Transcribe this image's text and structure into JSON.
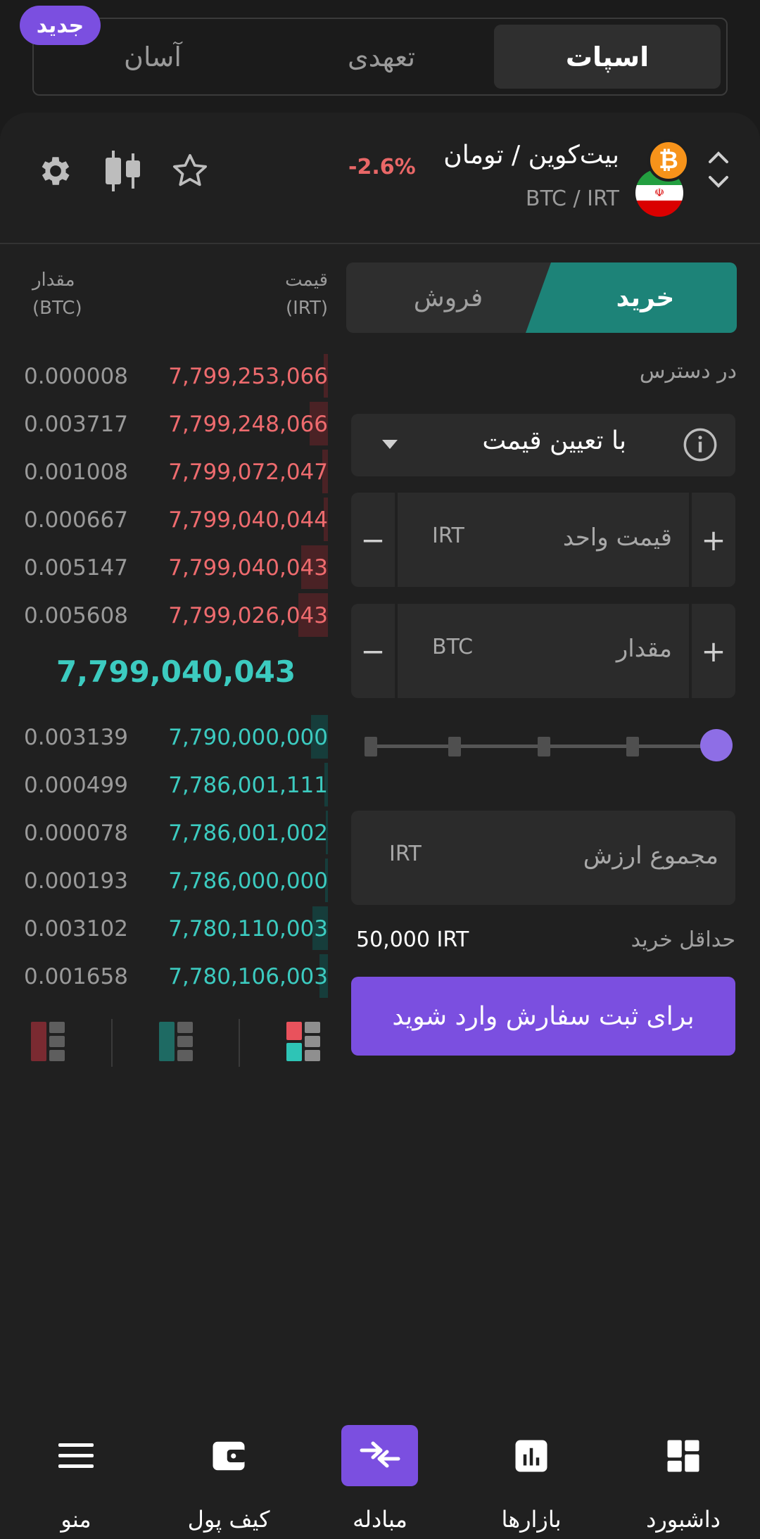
{
  "mode_tabs": {
    "spot": "اسپات",
    "margin": "تعهدی",
    "easy": "آسان",
    "new_badge": "جدید"
  },
  "pair": {
    "name": "بیت‌کوین / تومان",
    "symbol": "BTC / IRT",
    "change": "-2.6%",
    "coin_glyph": "₿"
  },
  "toolbar_icons": [
    "star-icon",
    "candlestick-icon",
    "gear-icon"
  ],
  "side_tabs": {
    "buy": "خرید",
    "sell": "فروش"
  },
  "form": {
    "available_label": "در دسترس",
    "order_type": "با تعیین قیمت",
    "price_label": "قیمت واحد",
    "price_unit": "IRT",
    "amount_label": "مقدار",
    "amount_unit": "BTC",
    "total_label": "مجموع ارزش",
    "total_unit": "IRT",
    "min_label": "حداقل خرید",
    "min_value": "50,000 IRT",
    "submit": "برای ثبت سفارش وارد شوید",
    "slider_percent": 100
  },
  "orderbook": {
    "price_header": "قیمت",
    "price_unit": "(IRT)",
    "qty_header": "مقدار",
    "qty_unit": "(BTC)",
    "asks": [
      {
        "price": "7,799,253,066",
        "qty": "0.000008"
      },
      {
        "price": "7,799,248,066",
        "qty": "0.003717"
      },
      {
        "price": "7,799,072,047",
        "qty": "0.001008"
      },
      {
        "price": "7,799,040,044",
        "qty": "0.000667"
      },
      {
        "price": "7,799,040,043",
        "qty": "0.005147"
      },
      {
        "price": "7,799,026,043",
        "qty": "0.005608"
      }
    ],
    "last_price": "7,799,040,043",
    "bids": [
      {
        "price": "7,790,000,000",
        "qty": "0.003139"
      },
      {
        "price": "7,786,001,111",
        "qty": "0.000499"
      },
      {
        "price": "7,786,001,002",
        "qty": "0.000078"
      },
      {
        "price": "7,786,000,000",
        "qty": "0.000193"
      },
      {
        "price": "7,780,110,003",
        "qty": "0.003102"
      },
      {
        "price": "7,780,106,003",
        "qty": "0.001658"
      }
    ]
  },
  "nav": {
    "dashboard": "داشبورد",
    "markets": "بازارها",
    "exchange": "مبادله",
    "wallet": "کیف پول",
    "menu": "منو"
  },
  "colors": {
    "accent": "#7b4fe0",
    "buy": "#1d8378",
    "ask": "#ee6b6e",
    "bid": "#3ccbc0"
  }
}
